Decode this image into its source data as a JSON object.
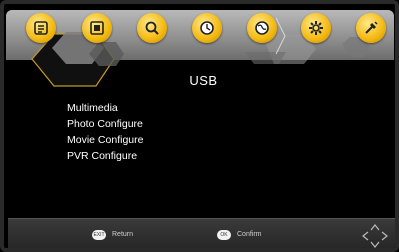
{
  "tabs": [
    {
      "name": "channel-list-icon"
    },
    {
      "name": "picture-icon"
    },
    {
      "name": "search-icon"
    },
    {
      "name": "clock-icon"
    },
    {
      "name": "globe-icon"
    },
    {
      "name": "gear-icon"
    },
    {
      "name": "usb-tool-icon"
    }
  ],
  "active_tab": 0,
  "page_title": "USB",
  "menu": {
    "items": [
      "Multimedia",
      "Photo Configure",
      "Movie Configure",
      "PVR Configure"
    ]
  },
  "footer": {
    "return": {
      "key": "EXIT",
      "label": "Return"
    },
    "confirm": {
      "key": "OK",
      "label": "Confirm"
    }
  },
  "colors": {
    "tab_bar": "#a0a0a0",
    "icon_yellow": "#f3b80f",
    "text": "#ffffff",
    "footer": "#2e2e2e"
  }
}
